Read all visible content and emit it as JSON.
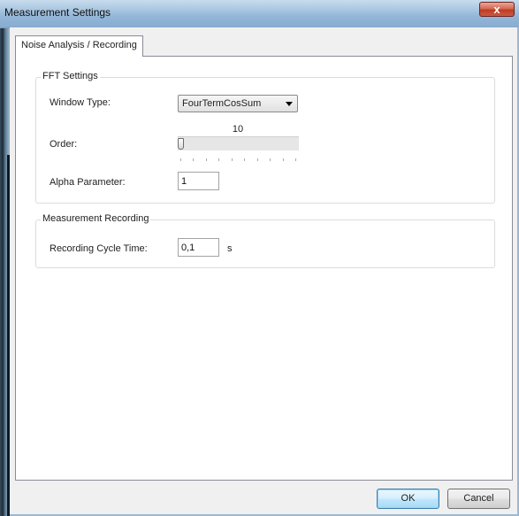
{
  "window": {
    "title": "Measurement Settings",
    "close_glyph": "x"
  },
  "tabs": [
    {
      "label": "Noise Analysis / Recording",
      "active": true
    }
  ],
  "fft_settings": {
    "title": "FFT Settings",
    "window_type": {
      "label": "Window Type:",
      "value": "FourTermCosSum"
    },
    "order": {
      "label": "Order:",
      "value": "10",
      "position_fraction": 0.0
    },
    "alpha": {
      "label": "Alpha Parameter:",
      "value": "1"
    }
  },
  "measurement_recording": {
    "title": "Measurement Recording",
    "cycle_time": {
      "label": "Recording Cycle Time:",
      "value": "0,1",
      "unit": "s"
    }
  },
  "buttons": {
    "ok": "OK",
    "cancel": "Cancel"
  },
  "colors": {
    "accent": "#3c7fb1",
    "close": "#c7432b"
  }
}
